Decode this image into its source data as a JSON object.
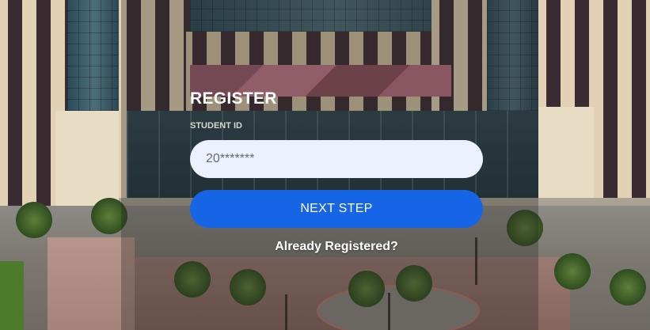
{
  "form": {
    "title": "REGISTER",
    "student_id_label": "STUDENT ID",
    "student_id_placeholder": "20*******",
    "student_id_value": "",
    "next_button_label": "NEXT STEP",
    "already_registered_link": "Already Registered?"
  },
  "colors": {
    "button_accent": "#1565e6",
    "input_background": "#ebf1fe",
    "title_text": "#ffffff"
  }
}
